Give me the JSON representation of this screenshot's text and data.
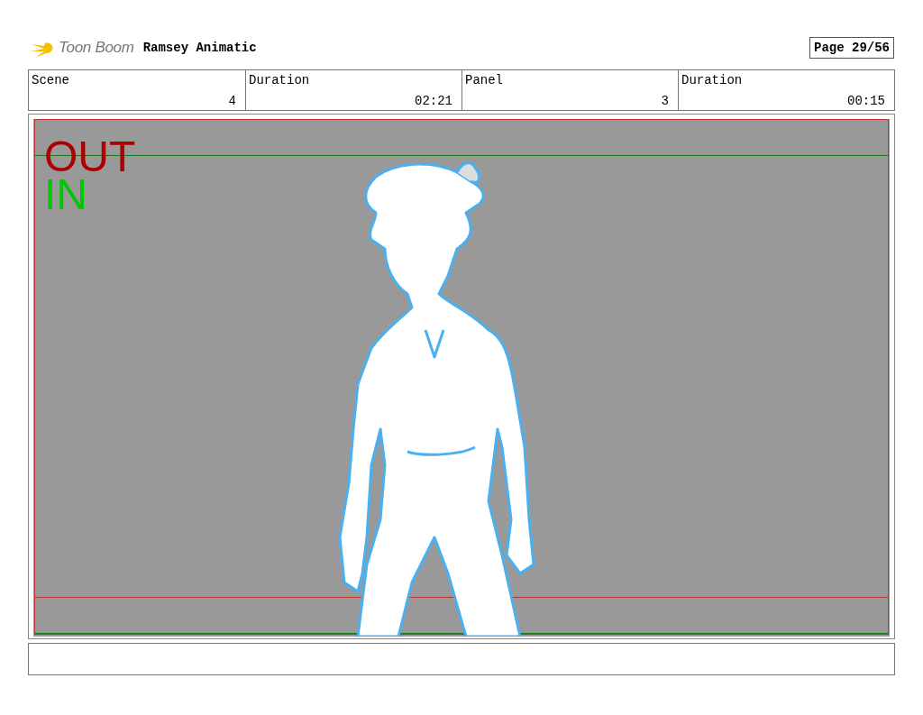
{
  "header": {
    "logo_text": "Toon Boom",
    "title": "Ramsey Animatic",
    "page": "Page 29/56"
  },
  "info": [
    {
      "label": "Scene",
      "value": "4"
    },
    {
      "label": "Duration",
      "value": "02:21"
    },
    {
      "label": "Panel",
      "value": "3"
    },
    {
      "label": "Duration",
      "value": "00:15"
    }
  ],
  "frame": {
    "labels": [
      {
        "text": "OUT",
        "color": "#aa0000"
      },
      {
        "text": "IN",
        "color": "#00c800"
      }
    ]
  }
}
